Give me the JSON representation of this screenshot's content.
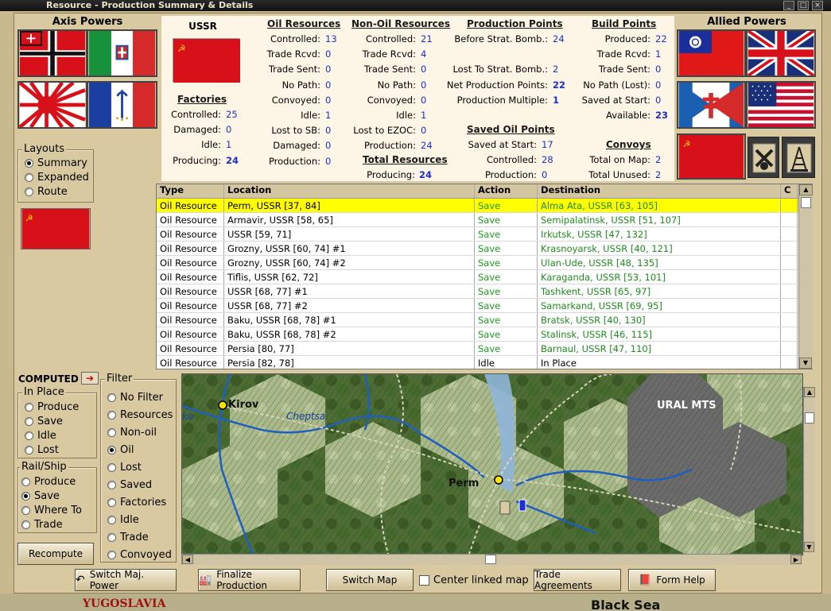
{
  "window": {
    "title": "Resource - Production Summary & Details"
  },
  "axis": {
    "title": "Axis Powers"
  },
  "allied": {
    "title": "Allied Powers"
  },
  "country": {
    "name": "USSR"
  },
  "layouts": {
    "title": "Layouts",
    "options": [
      "Summary",
      "Expanded",
      "Route"
    ],
    "selected": 0
  },
  "factories": {
    "title": "Factories",
    "rows": [
      {
        "label": "Controlled:",
        "value": "25"
      },
      {
        "label": "Damaged:",
        "value": "0"
      },
      {
        "label": "Idle:",
        "value": "1"
      },
      {
        "label": "Producing:",
        "value": "24"
      }
    ]
  },
  "oil_resources": {
    "title": "Oil Resources",
    "rows": [
      {
        "label": "Controlled:",
        "value": "13"
      },
      {
        "label": "Trade Rcvd:",
        "value": "0"
      },
      {
        "label": "Trade Sent:",
        "value": "0"
      },
      {
        "label": "No Path:",
        "value": "0"
      },
      {
        "label": "Convoyed:",
        "value": "0"
      },
      {
        "label": "Idle:",
        "value": "1"
      },
      {
        "label": "Lost to SB:",
        "value": "0"
      },
      {
        "label": "Damaged:",
        "value": "0"
      },
      {
        "label": "Production:",
        "value": "0"
      }
    ]
  },
  "non_oil_resources": {
    "title": "Non-Oil Resources",
    "rows": [
      {
        "label": "Controlled:",
        "value": "21"
      },
      {
        "label": "Trade Rcvd:",
        "value": "4"
      },
      {
        "label": "Trade Sent:",
        "value": "0"
      },
      {
        "label": "No Path:",
        "value": "0"
      },
      {
        "label": "Convoyed:",
        "value": "0"
      },
      {
        "label": "Idle:",
        "value": "1"
      },
      {
        "label": "Lost to EZOC:",
        "value": "0"
      },
      {
        "label": "Production:",
        "value": "24"
      }
    ]
  },
  "total_resources": {
    "title": "Total Resources",
    "label": "Producing:",
    "value": "24"
  },
  "production_points": {
    "title": "Production Points",
    "rows": [
      {
        "label": "Before Strat. Bomb.:",
        "value": "24"
      },
      {
        "label": "Lost To Strat. Bomb.:",
        "value": "2"
      },
      {
        "label": "Net Production Points:",
        "value": "22"
      },
      {
        "label": "Production Multiple:",
        "value": "1"
      }
    ]
  },
  "saved_oil_points": {
    "title": "Saved Oil Points",
    "rows": [
      {
        "label": "Saved at Start:",
        "value": "17"
      },
      {
        "label": "Controlled:",
        "value": "28"
      },
      {
        "label": "Production:",
        "value": "0"
      }
    ]
  },
  "build_points": {
    "title": "Build Points",
    "rows": [
      {
        "label": "Produced:",
        "value": "22"
      },
      {
        "label": "Trade Rcvd:",
        "value": "1"
      },
      {
        "label": "Trade Sent:",
        "value": "0"
      },
      {
        "label": "No Path (Lost):",
        "value": "0"
      },
      {
        "label": "Saved at Start:",
        "value": "0"
      },
      {
        "label": "Available:",
        "value": "23"
      }
    ]
  },
  "convoys": {
    "title": "Convoys",
    "rows": [
      {
        "label": "Total on Map:",
        "value": "2"
      },
      {
        "label": "Total Unused:",
        "value": "2"
      }
    ]
  },
  "table": {
    "headers": [
      "Type",
      "Location",
      "Action",
      "Destination",
      "C"
    ],
    "rows": [
      {
        "type": "Oil Resource",
        "location": "Perm, USSR [37, 84]",
        "action": "Save",
        "destination": "Alma Ata, USSR [63, 105]"
      },
      {
        "type": "Oil Resource",
        "location": "Armavir, USSR [58, 65]",
        "action": "Save",
        "destination": "Semipalatinsk, USSR [51, 107]"
      },
      {
        "type": "Oil Resource",
        "location": "USSR [59, 71]",
        "action": "Save",
        "destination": "Irkutsk, USSR [47, 132]"
      },
      {
        "type": "Oil Resource",
        "location": "Grozny, USSR [60, 74] #1",
        "action": "Save",
        "destination": "Krasnoyarsk, USSR [40, 121]"
      },
      {
        "type": "Oil Resource",
        "location": "Grozny, USSR [60, 74] #2",
        "action": "Save",
        "destination": "Ulan-Ude, USSR [48, 135]"
      },
      {
        "type": "Oil Resource",
        "location": "Tiflis, USSR [62, 72]",
        "action": "Save",
        "destination": "Karaganda, USSR [53, 101]"
      },
      {
        "type": "Oil Resource",
        "location": "USSR [68, 77] #1",
        "action": "Save",
        "destination": "Tashkent, USSR [65, 97]"
      },
      {
        "type": "Oil Resource",
        "location": "USSR [68, 77] #2",
        "action": "Save",
        "destination": "Samarkand, USSR [69, 95]"
      },
      {
        "type": "Oil Resource",
        "location": "Baku, USSR [68, 78] #1",
        "action": "Save",
        "destination": "Bratsk, USSR [40, 130]"
      },
      {
        "type": "Oil Resource",
        "location": "Baku, USSR [68, 78] #2",
        "action": "Save",
        "destination": "Stalinsk, USSR [46, 115]"
      },
      {
        "type": "Oil Resource",
        "location": "Persia [80, 77]",
        "action": "Save",
        "destination": "Barnaul, USSR [47, 110]"
      },
      {
        "type": "Oil Resource",
        "location": "Persia [82, 78]",
        "action": "Idle",
        "destination": "In Place"
      }
    ]
  },
  "computed": {
    "label": "COMPUTED"
  },
  "in_place": {
    "title": "In Place",
    "options": [
      "Produce",
      "Save",
      "Idle",
      "Lost"
    ],
    "selected": -1
  },
  "rail_ship": {
    "title": "Rail/Ship",
    "options": [
      "Produce",
      "Save",
      "Where To",
      "Trade"
    ],
    "selected": 1
  },
  "filter": {
    "title": "Filter",
    "options": [
      "No Filter",
      "Resources",
      "Non-oil",
      "Oil",
      "Lost",
      "Saved",
      "Factories",
      "Idle",
      "Trade",
      "Convoyed"
    ],
    "selected": 3
  },
  "buttons": {
    "recompute": "Recompute",
    "switch_major_power": "Switch Maj. Power",
    "finalize_production": "Finalize Production",
    "switch_map": "Switch Map",
    "center_linked_map": "Center linked map",
    "trade_agreements": "Trade Agreements",
    "form_help": "Form Help"
  },
  "map": {
    "labels": {
      "kirov": "Kirov",
      "cheptsa": "Cheptsa",
      "ka": "ka",
      "ural": "URAL MTS",
      "perm": "Perm"
    }
  },
  "bottom_map_fragments": {
    "left": "YUGOSLAVIA",
    "right": "Black Sea"
  },
  "colors": {
    "accent_blue": "#1a2fcc",
    "save_green": "#1e9a1e",
    "selected_row": "#ffff00"
  }
}
